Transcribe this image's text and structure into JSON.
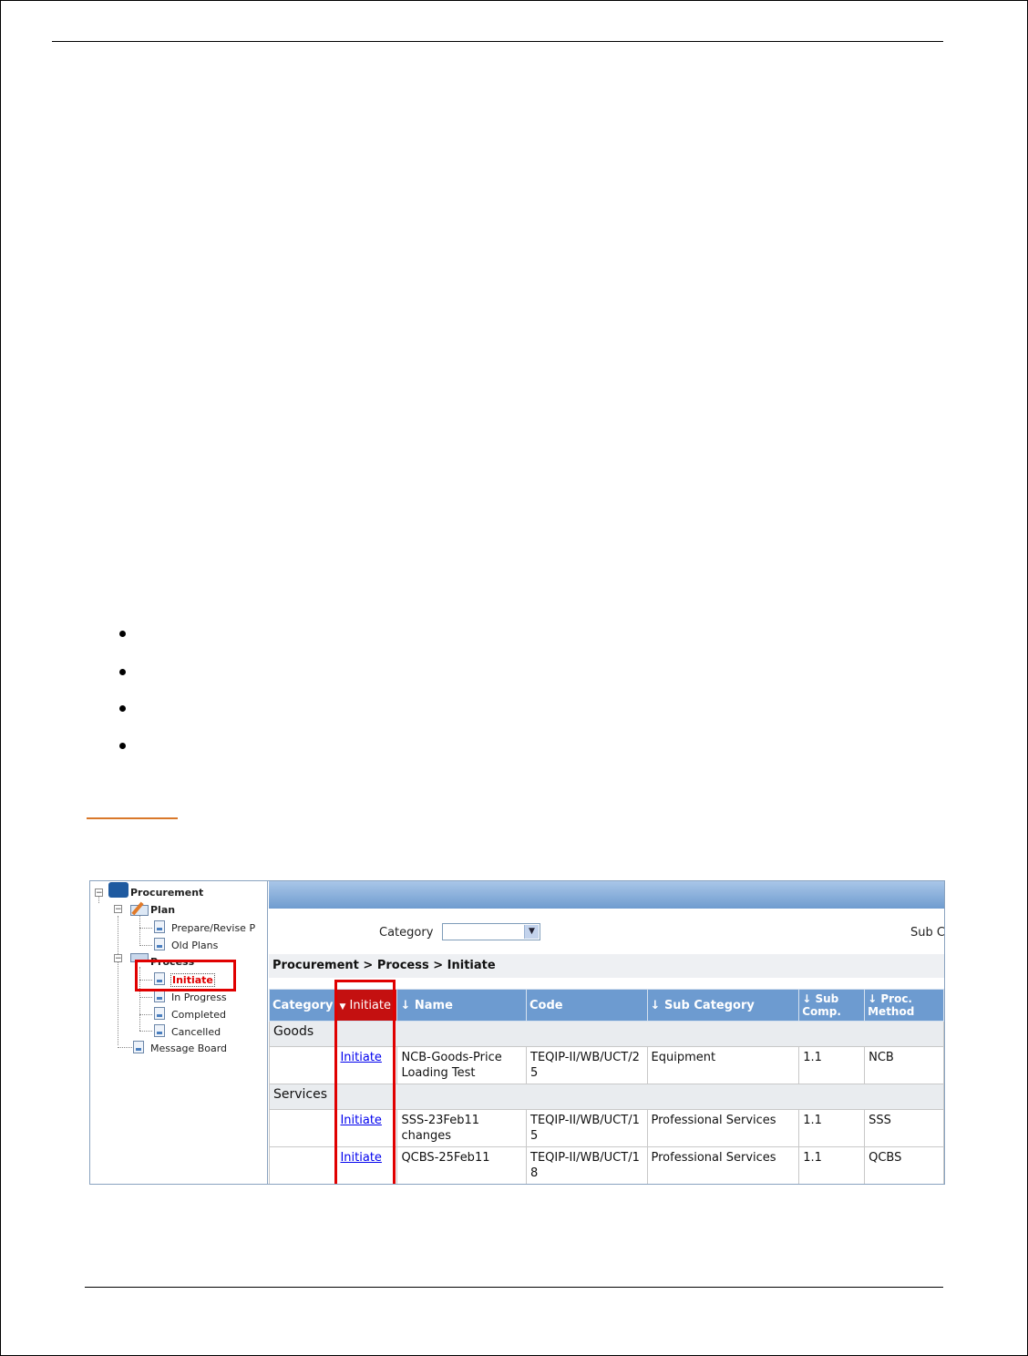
{
  "tree": {
    "root": "Procurement",
    "plan": "Plan",
    "prepare": "Prepare/Revise P",
    "old_plans": "Old Plans",
    "process": "Process",
    "initiate": "Initiate",
    "in_progress": "In Progress",
    "completed": "Completed",
    "cancelled": "Cancelled",
    "message_board": "Message Board"
  },
  "filters": {
    "category_label": "Category",
    "category_value": "",
    "sub_label": "Sub C"
  },
  "breadcrumb": "Procurement > Process > Initiate",
  "table": {
    "headers": {
      "category": "Category",
      "initiate": "Initiate",
      "name": "Name",
      "code": "Code",
      "sub_category": "Sub Category",
      "sub_comp": "Sub Comp.",
      "proc_method": "Proc. Method"
    },
    "groups": [
      {
        "label": "Goods",
        "rows": [
          {
            "action": "Initiate",
            "name": "NCB-Goods-Price Loading Test",
            "code": "TEQIP-II/WB/UCT/25",
            "sub_category": "Equipment",
            "sub_comp": "1.1",
            "method": "NCB"
          }
        ]
      },
      {
        "label": "Services",
        "rows": [
          {
            "action": "Initiate",
            "name": "SSS-23Feb11 changes",
            "code": "TEQIP-II/WB/UCT/15",
            "sub_category": "Professional Services",
            "sub_comp": "1.1",
            "method": "SSS"
          },
          {
            "action": "Initiate",
            "name": "QCBS-25Feb11",
            "code": "TEQIP-II/WB/UCT/18",
            "sub_category": "Professional Services",
            "sub_comp": "1.1",
            "method": "QCBS"
          }
        ]
      }
    ]
  },
  "colors": {
    "header_blue": "#6d9bd0",
    "active_header_red": "#c41010",
    "highlight_red": "#e00000",
    "accent_orange": "#d9782a"
  }
}
